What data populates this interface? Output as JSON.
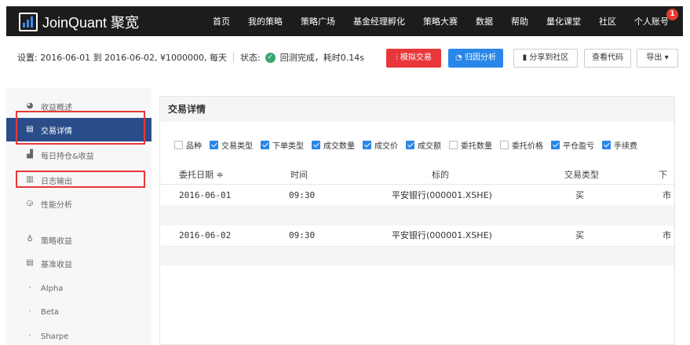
{
  "brand": {
    "name": "JoinQuant 聚宽"
  },
  "nav": {
    "items": [
      "首页",
      "我的策略",
      "策略广场",
      "基金经理孵化",
      "策略大赛",
      "数据",
      "帮助",
      "量化课堂",
      "社区",
      "个人账号"
    ],
    "badge": "1"
  },
  "settings": {
    "text": "设置:  2016-06-01 到 2016-06-02,  ¥1000000,  每天",
    "status_label": "状态:",
    "status_text": "回测完成，耗时0.14s"
  },
  "toolbar": {
    "simulate": "模拟交易",
    "attribution": "归因分析",
    "share": "分享到社区",
    "view_code": "查看代码",
    "export": "导出 ▾"
  },
  "sidebar": {
    "items": [
      {
        "label": "收益概述",
        "icon": "chart-pie-icon"
      },
      {
        "label": "交易详情",
        "icon": "document-icon"
      },
      {
        "label": "每日持仓&收益",
        "icon": "bar-chart-icon"
      },
      {
        "label": "日志输出",
        "icon": "log-icon"
      },
      {
        "label": "性能分析",
        "icon": "gauge-icon"
      },
      {
        "label": "策略收益",
        "icon": "bulb-icon"
      },
      {
        "label": "基准收益",
        "icon": "database-icon"
      },
      {
        "label": "Alpha",
        "icon": "dot"
      },
      {
        "label": "Beta",
        "icon": "dot"
      },
      {
        "label": "Sharpe",
        "icon": "dot"
      }
    ]
  },
  "panel": {
    "title": "交易详情",
    "filters": [
      {
        "label": "品种",
        "checked": false
      },
      {
        "label": "交易类型",
        "checked": true
      },
      {
        "label": "下单类型",
        "checked": true
      },
      {
        "label": "成交数量",
        "checked": true
      },
      {
        "label": "成交价",
        "checked": true
      },
      {
        "label": "成交额",
        "checked": true
      },
      {
        "label": "委托数量",
        "checked": false
      },
      {
        "label": "委托价格",
        "checked": false
      },
      {
        "label": "平仓盈亏",
        "checked": true
      },
      {
        "label": "手续费",
        "checked": true
      }
    ],
    "columns": [
      "委托日期 ≑",
      "时间",
      "标的",
      "交易类型",
      "下"
    ],
    "rows": [
      {
        "date": "2016-06-01",
        "time": "09:30",
        "symbol": "平安银行(000001.XSHE)",
        "type": "买",
        "next": "市"
      },
      {
        "date": "2016-06-02",
        "time": "09:30",
        "symbol": "平安银行(000001.XSHE)",
        "type": "买",
        "next": "市"
      }
    ]
  },
  "colors": {
    "accent": "#2a86e8",
    "active_sidebar": "#2a4d8a",
    "highlight": "#e8373a",
    "topbar": "#1c1c1c"
  }
}
